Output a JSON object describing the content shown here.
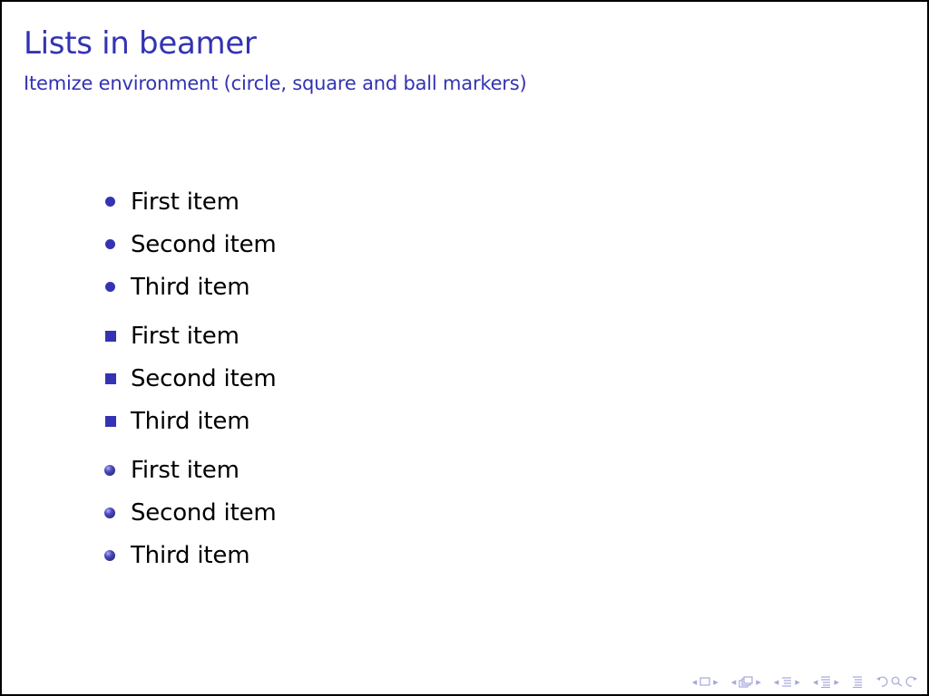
{
  "slide": {
    "title": "Lists in beamer",
    "subtitle": "Itemize environment (circle, square and ball markers)",
    "accent_color": "#3333b3"
  },
  "lists": [
    {
      "marker": "circle",
      "items": [
        "First item",
        "Second item",
        "Third item"
      ]
    },
    {
      "marker": "square",
      "items": [
        "First item",
        "Second item",
        "Third item"
      ]
    },
    {
      "marker": "ball",
      "items": [
        "First item",
        "Second item",
        "Third item"
      ]
    }
  ],
  "navigation": {
    "arrow_left": "◂",
    "arrow_right": "▸",
    "icons": [
      "frame-nav-icon",
      "subsection-nav-icon",
      "section-nav-icon",
      "subsection-list-icon",
      "document-nav-icon",
      "back-icon",
      "search-icon",
      "forward-icon"
    ]
  }
}
